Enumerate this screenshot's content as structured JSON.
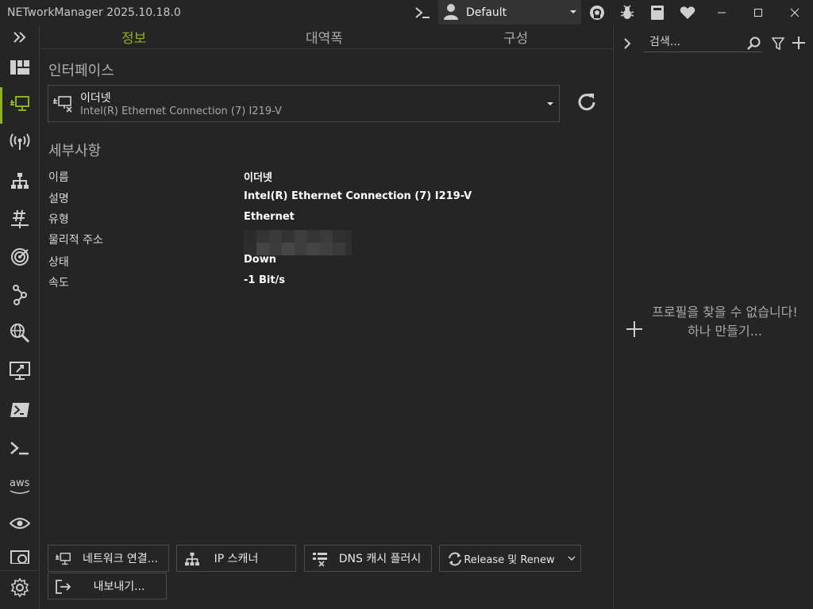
{
  "app": {
    "title": "NETworkManager 2025.10.18.0"
  },
  "titlebar": {
    "profile_value": "Default",
    "icons": [
      "terminal-icon",
      "github-icon",
      "bug-icon",
      "book-icon",
      "heart-icon"
    ]
  },
  "tabs": [
    {
      "label": "정보",
      "active": true
    },
    {
      "label": "대역폭",
      "active": false
    },
    {
      "label": "구성",
      "active": false
    }
  ],
  "sidebar": {
    "items": [
      {
        "name": "dashboard-icon"
      },
      {
        "name": "network-interface-icon",
        "active": true
      },
      {
        "name": "wifi-icon"
      },
      {
        "name": "ip-scanner-icon"
      },
      {
        "name": "port-scanner-icon"
      },
      {
        "name": "ping-monitor-icon"
      },
      {
        "name": "traceroute-icon"
      },
      {
        "name": "dns-lookup-icon"
      },
      {
        "name": "remote-desktop-icon"
      },
      {
        "name": "powershell-icon"
      },
      {
        "name": "putty-icon"
      },
      {
        "name": "aws-icon",
        "label": "aws"
      },
      {
        "name": "tigervnc-icon"
      },
      {
        "name": "web-console-icon"
      }
    ],
    "accent": "#8eb31f"
  },
  "main": {
    "interface_heading": "인터페이스",
    "interface": {
      "name": "이더넷",
      "description": "Intel(R) Ethernet Connection (7) I219-V"
    },
    "details_heading": "세부사항",
    "details": [
      {
        "key": "이름",
        "value": "이더넷"
      },
      {
        "key": "설명",
        "value": "Intel(R) Ethernet Connection (7) I219-V"
      },
      {
        "key": "유형",
        "value": "Ethernet"
      },
      {
        "key": "물리적 주소",
        "value": ""
      },
      {
        "key": "상태",
        "value": "Down"
      },
      {
        "key": "속도",
        "value": "-1 Bit/s"
      }
    ]
  },
  "buttons": {
    "network_connections": "네트워크 연결...",
    "ip_scanner": "IP 스캐너",
    "flush_dns": "DNS 캐시 플러시",
    "release_renew": "Release 및 Renew",
    "export": "내보내기..."
  },
  "right_panel": {
    "search_placeholder": "검색...",
    "empty_line1": "프로필을 찾을 수 없습니다!",
    "empty_line2": "하나 만들기..."
  }
}
